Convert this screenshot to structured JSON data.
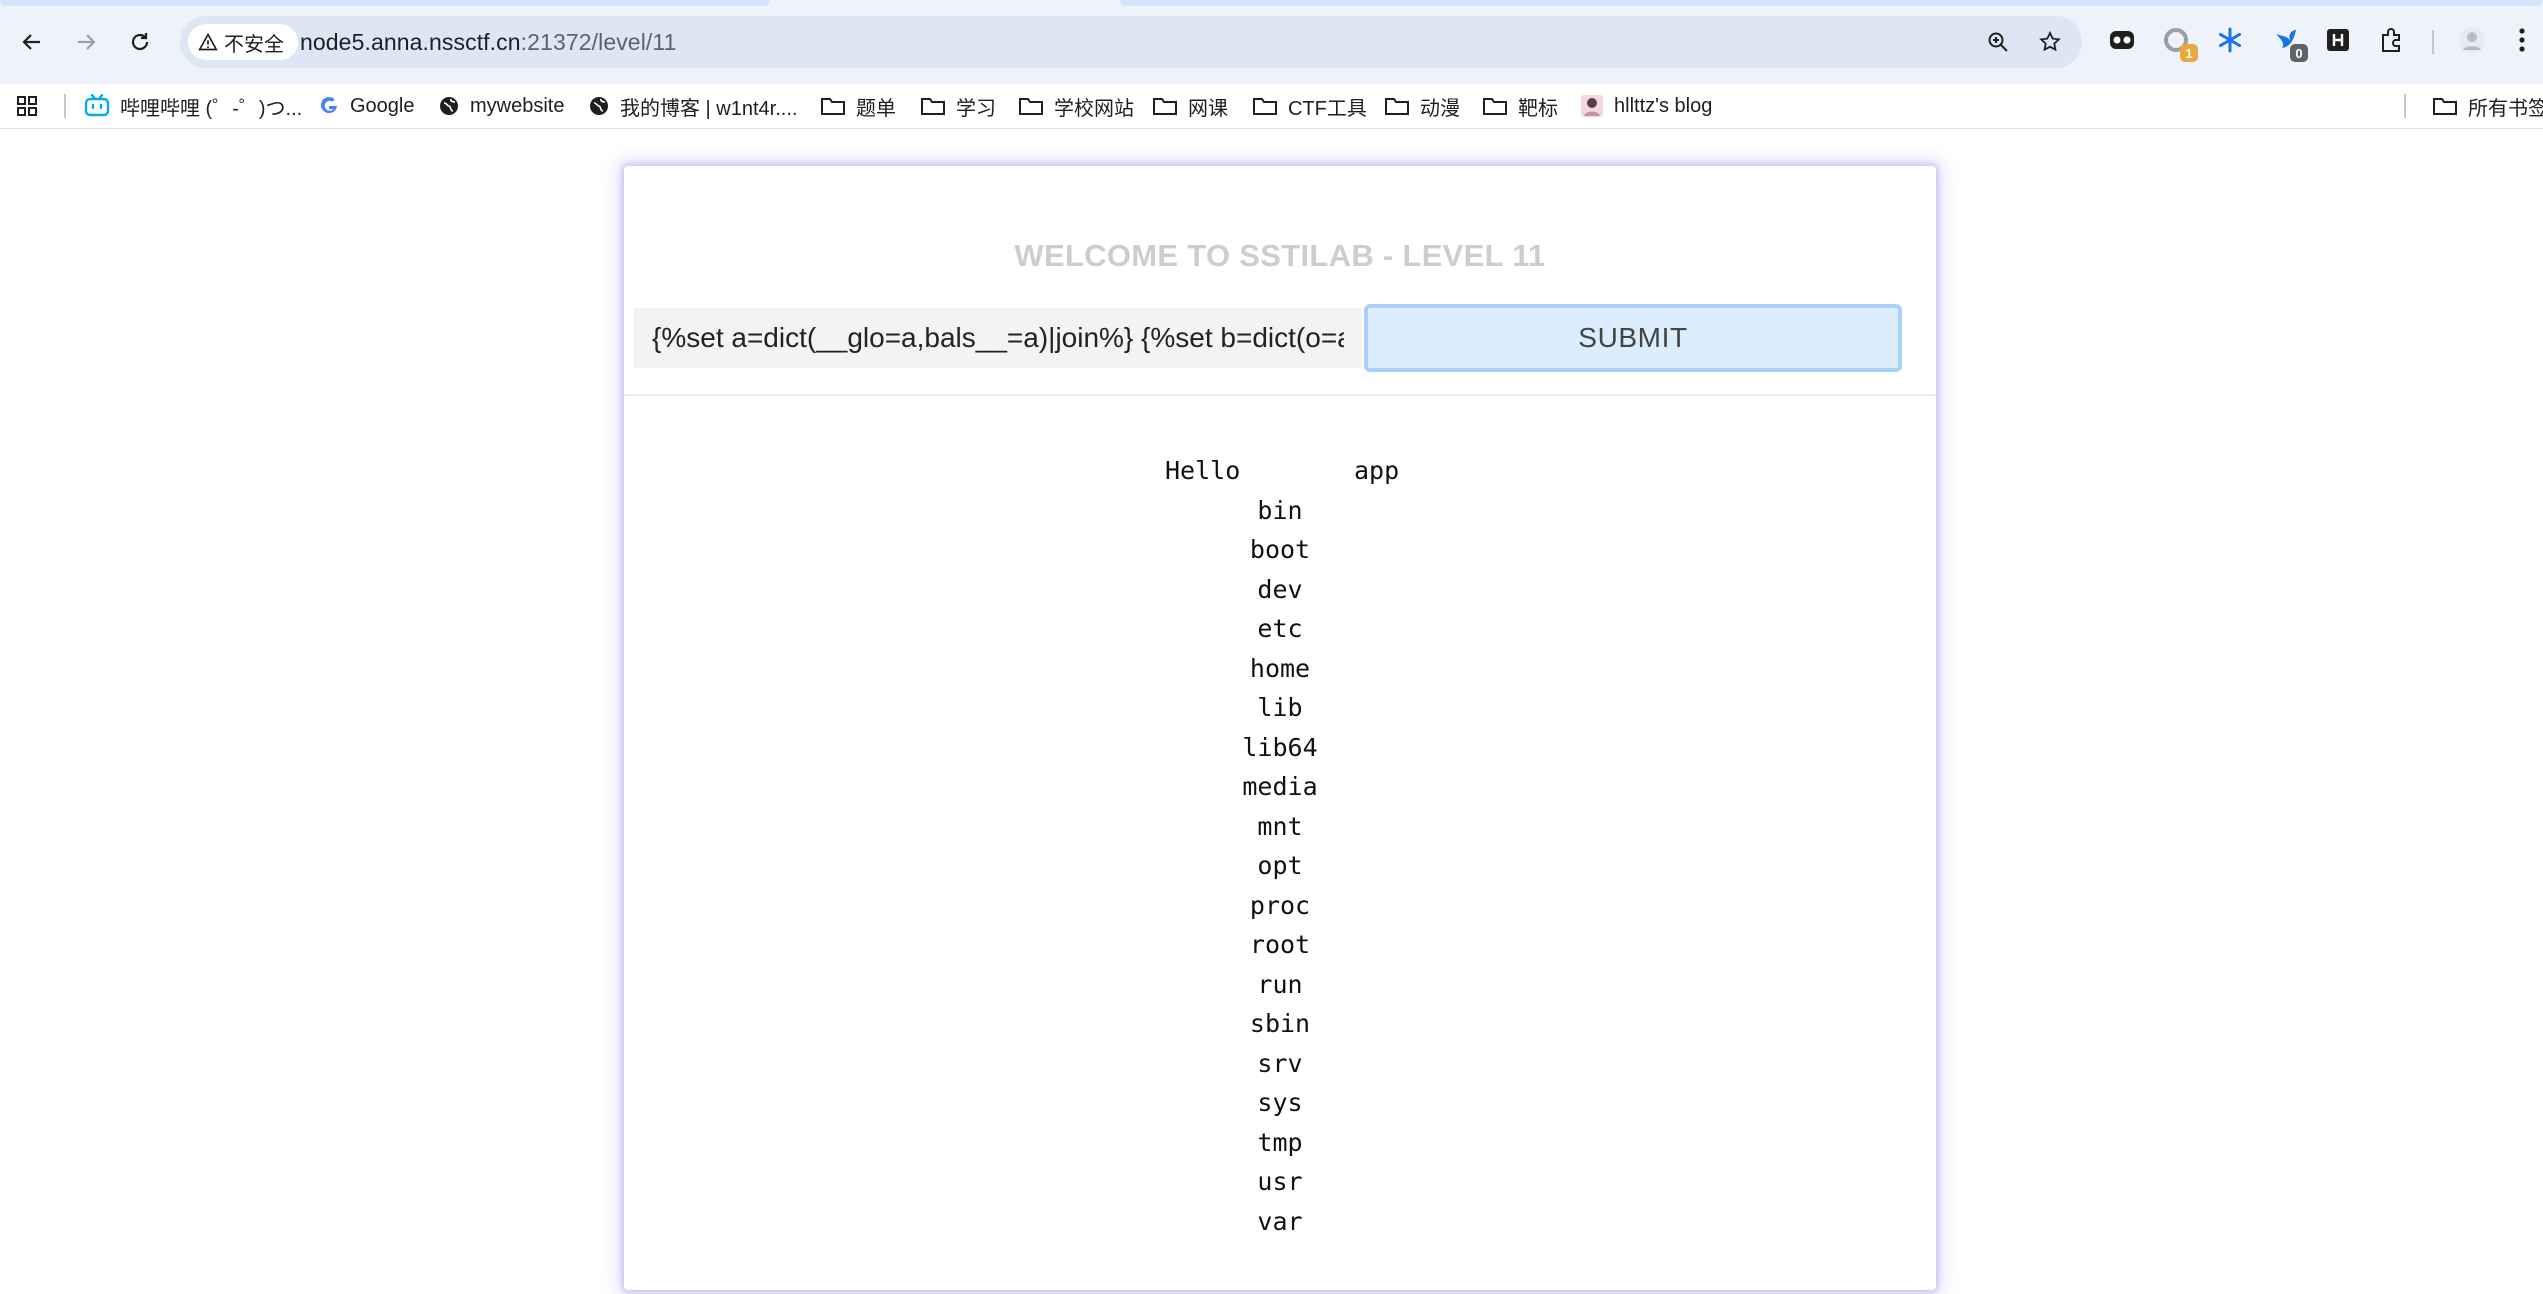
{
  "browser": {
    "security_label": "不安全",
    "url_host": "node5.anna.nssctf.cn",
    "url_rest": ":21372/level/11",
    "extension_badges": [
      "1",
      "0"
    ]
  },
  "bookmarks": [
    {
      "label": "哔哩哔哩 (゜-゜)つ...",
      "icon": "bilibili-icon"
    },
    {
      "label": "Google",
      "icon": "google-icon"
    },
    {
      "label": "mywebsite",
      "icon": "globe-icon"
    },
    {
      "label": "我的博客 | w1nt4r....",
      "icon": "globe-icon"
    },
    {
      "label": "题单",
      "icon": "folder-icon"
    },
    {
      "label": "学习",
      "icon": "folder-icon"
    },
    {
      "label": "学校网站",
      "icon": "folder-icon"
    },
    {
      "label": "网课",
      "icon": "folder-icon"
    },
    {
      "label": "CTF工具",
      "icon": "folder-icon"
    },
    {
      "label": "动漫",
      "icon": "folder-icon"
    },
    {
      "label": "靶标",
      "icon": "folder-icon"
    },
    {
      "label": "hllttz's blog",
      "icon": "avatar-icon"
    }
  ],
  "all_bookmarks_label": "所有书签",
  "page": {
    "title": "WELCOME TO SSTILAB - LEVEL 11",
    "input_value": "{%set a=dict(__glo=a,bals__=a)|join%} {%set b=dict(o=a,",
    "submit_label": "SUBMIT",
    "hello": "Hello",
    "output_lines": [
      "app",
      "bin",
      "boot",
      "dev",
      "etc",
      "home",
      "lib",
      "lib64",
      "media",
      "mnt",
      "opt",
      "proc",
      "root",
      "run",
      "sbin",
      "srv",
      "sys",
      "tmp",
      "usr",
      "var"
    ]
  },
  "colors": {
    "chrome_bg": "#eef3fb",
    "omnibox_bg": "#dde6f4",
    "title_gray": "#cdcdcd",
    "button_bg": "#dbedfd",
    "button_border": "#a9d0f7",
    "card_glow": "#c9c2f6"
  }
}
